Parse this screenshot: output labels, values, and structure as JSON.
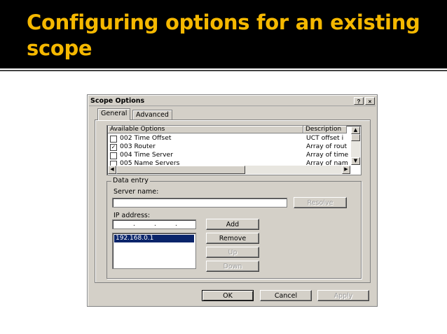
{
  "slide": {
    "title": "Configuring options for an existing scope"
  },
  "dialog": {
    "title": "Scope Options",
    "help_button": "?",
    "close_button": "×",
    "tabs": [
      {
        "label": "General",
        "selected": true
      },
      {
        "label": "Advanced",
        "selected": false
      }
    ],
    "options_list": {
      "columns": [
        "Available Options",
        "Description"
      ],
      "rows": [
        {
          "name": "002 Time Offset",
          "description": "UCT offset i",
          "checked": false
        },
        {
          "name": "003 Router",
          "description": "Array of rout",
          "checked": true
        },
        {
          "name": "004 Time Server",
          "description": "Array of time",
          "checked": false
        },
        {
          "name": "005 Name Servers",
          "description": "Array of nam",
          "checked": false
        }
      ]
    },
    "data_entry": {
      "group_label": "Data entry",
      "server_name_label": "Server name:",
      "server_name_value": "",
      "resolve_button": "Resolve",
      "ip_address_label": "IP address:",
      "ip_placeholder_dots": ".",
      "ip_addresses": [
        "192.168.0.1"
      ],
      "add_button": "Add",
      "remove_button": "Remove",
      "up_button": "Up",
      "down_button": "Down"
    },
    "footer": {
      "ok_button": "OK",
      "cancel_button": "Cancel",
      "apply_button": "Apply"
    }
  },
  "colors": {
    "title": "#f5b800",
    "header_bg": "#000000",
    "dialog_bg": "#d4d0c8",
    "selection": "#0a246a"
  }
}
